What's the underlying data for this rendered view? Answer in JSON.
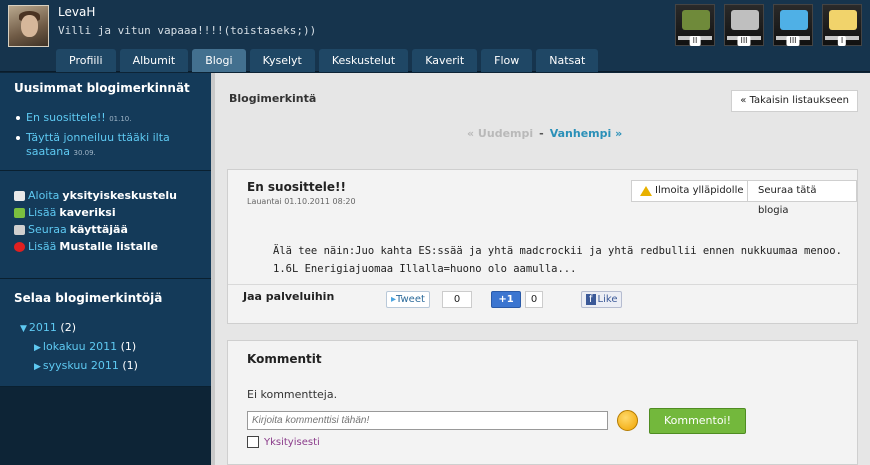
{
  "user": {
    "name": "LevaH",
    "status": "Villi ja vitun vapaaa!!!!(toistaseks;))"
  },
  "nav": {
    "tabs": [
      "Profiili",
      "Albumit",
      "Blogi",
      "Kyselyt",
      "Keskustelut",
      "Kaverit",
      "Flow",
      "Natsat"
    ],
    "active": "Blogi"
  },
  "badges": [
    {
      "icon": "award-badge-icon",
      "count": "II",
      "color": "#6f8a3a"
    },
    {
      "icon": "camera-badge-icon",
      "count": "III",
      "color": "#bfbfbf"
    },
    {
      "icon": "hearts-badge-icon",
      "count": "III",
      "color": "#4fb0e6"
    },
    {
      "icon": "notepad-badge-icon",
      "count": "I",
      "color": "#f1d36b"
    }
  ],
  "sidebar": {
    "latest_title": "Uusimmat blogimerkinnät",
    "latest": [
      {
        "title": "En suosittele!!",
        "date": "01.10."
      },
      {
        "title_l1": "Täyttä jonneiluu ttääki ilta",
        "title_l2": "saatana",
        "date": "30.09."
      }
    ],
    "actions": [
      {
        "verb": "Aloita",
        "obj": "yksityiskeskustelu",
        "icon": "chat-icon"
      },
      {
        "verb": "Lisää",
        "obj": "kaveriksi",
        "icon": "add-friend-icon"
      },
      {
        "verb": "Seuraa",
        "obj": "käyttäjää",
        "icon": "follow-icon"
      },
      {
        "verb": "Lisää",
        "obj": "Mustalle listalle",
        "icon": "block-icon"
      }
    ],
    "browse_title": "Selaa blogimerkintöjä",
    "year": {
      "label": "2011",
      "count": "(2)"
    },
    "months": [
      {
        "label": "lokakuu 2011",
        "count": "(1)"
      },
      {
        "label": "syyskuu 2011",
        "count": "(1)"
      }
    ]
  },
  "main": {
    "title": "Blogimerkintä",
    "back": "« Takaisin listaukseen",
    "pager": {
      "newer": "« Uudempi",
      "sep": "-",
      "older": "Vanhempi »"
    }
  },
  "post": {
    "title": "En suosittele!!",
    "date": "Lauantai 01.10.2011 08:20",
    "report": "Ilmoita ylläpidolle",
    "follow": "Seuraa tätä blogia",
    "body_l1": "Älä tee näin:Juo kahta ES:ssää ja yhtä madcrockii ja yhtä redbullii ennen nukkuumaa menoo.",
    "body_l2": "1.6L Enerigiajuomaa Illalla=huono olo aamulla...",
    "share_label": "Jaa palveluihin",
    "tweet": "Tweet",
    "tweet_count": "0",
    "plus": "+1",
    "plus_count": "0",
    "like": "Like"
  },
  "comments": {
    "title": "Kommentit",
    "none": "Ei kommentteja.",
    "placeholder": "Kirjoita kommenttisi tähän!",
    "submit": "Kommentoi!",
    "private": "Yksityisesti"
  }
}
